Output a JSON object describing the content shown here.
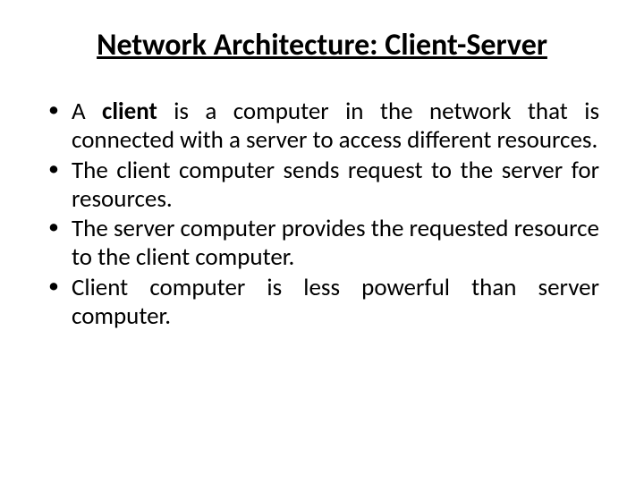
{
  "title": "Network Architecture: Client-Server",
  "bullets": [
    {
      "pre": "A ",
      "bold": "client",
      "post": " is a computer in the network that is connected with a server to access different resources."
    },
    {
      "pre": "The client computer sends request to the server for resources.",
      "bold": "",
      "post": ""
    },
    {
      "pre": "The server computer provides the requested resource to the client computer.",
      "bold": "",
      "post": ""
    },
    {
      "pre": "Client computer is less powerful than server computer.",
      "bold": "",
      "post": ""
    }
  ]
}
